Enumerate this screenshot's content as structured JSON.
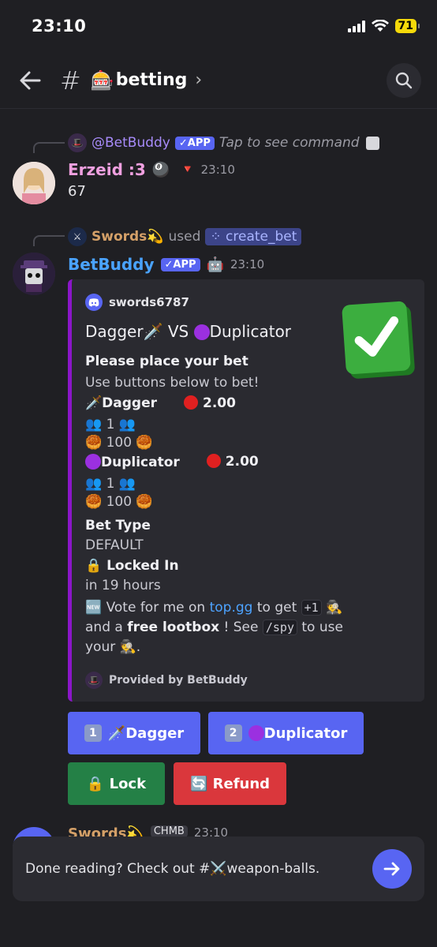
{
  "status_bar": {
    "time": "23:10",
    "battery": "71"
  },
  "header": {
    "channel_name": "betting",
    "channel_emoji": "🎰"
  },
  "reply1": {
    "app_name": "@BetBuddy",
    "app_badge": "✓APP",
    "hint": "Tap to see command"
  },
  "msg1": {
    "author": "Erzeid :3",
    "emoji": "🎱",
    "badge": "🔻",
    "time": "23:10",
    "text": "67",
    "name_color": "#f0a0e0"
  },
  "reply2": {
    "user": "Swords",
    "user_emoji": "💫",
    "used_text": "used",
    "command": "create_bet"
  },
  "msg2": {
    "author": "BetBuddy",
    "app_badge": "✓APP",
    "emoji": "🤖",
    "time": "23:10",
    "embed": {
      "author": "swords6787",
      "title_left": "Dagger🗡️",
      "title_vs": "VS",
      "title_right": "Duplicator",
      "field1_name": "Please place your bet",
      "field1_value": "Use buttons below to bet!",
      "opt1_name": "🗡️Dagger",
      "opt1_odds": "2.00",
      "opt1_users": "👥 1 👥",
      "opt1_pool": "🥮 100 🥮",
      "opt2_name": "Duplicator",
      "opt2_odds": "2.00",
      "opt2_users": "👥 1 👥",
      "opt2_pool": "🥮 100 🥮",
      "bet_type_name": "Bet Type",
      "bet_type_value": "DEFAULT",
      "locked_name": "🔒 Locked In",
      "locked_value": "in 19 hours",
      "promo_new": "🆕",
      "promo_text1": "Vote for me on",
      "promo_link": "top.gg",
      "promo_text2": "to get",
      "promo_plus": "+1",
      "promo_spy": "🕵️",
      "promo_text3": "and a",
      "promo_bold": "free lootbox",
      "promo_text4": "! See",
      "promo_cmd": "/spy",
      "promo_text5": "to use",
      "promo_text6": "your",
      "promo_spy2": "🕵️.",
      "footer": "Provided by BetBuddy"
    }
  },
  "buttons": {
    "dagger": {
      "num": "1",
      "label": "🗡️Dagger"
    },
    "duplicator": {
      "num": "2",
      "label": "Duplicator"
    },
    "lock": {
      "label": "🔒 Lock"
    },
    "refund": {
      "label": "🔄 Refund"
    }
  },
  "partial_msg": {
    "author": "Swords💫",
    "badge": "CHMB",
    "time": "23:10"
  },
  "bottom_prompt": {
    "text": "Done reading? Check out #⚔️weapon-balls."
  }
}
